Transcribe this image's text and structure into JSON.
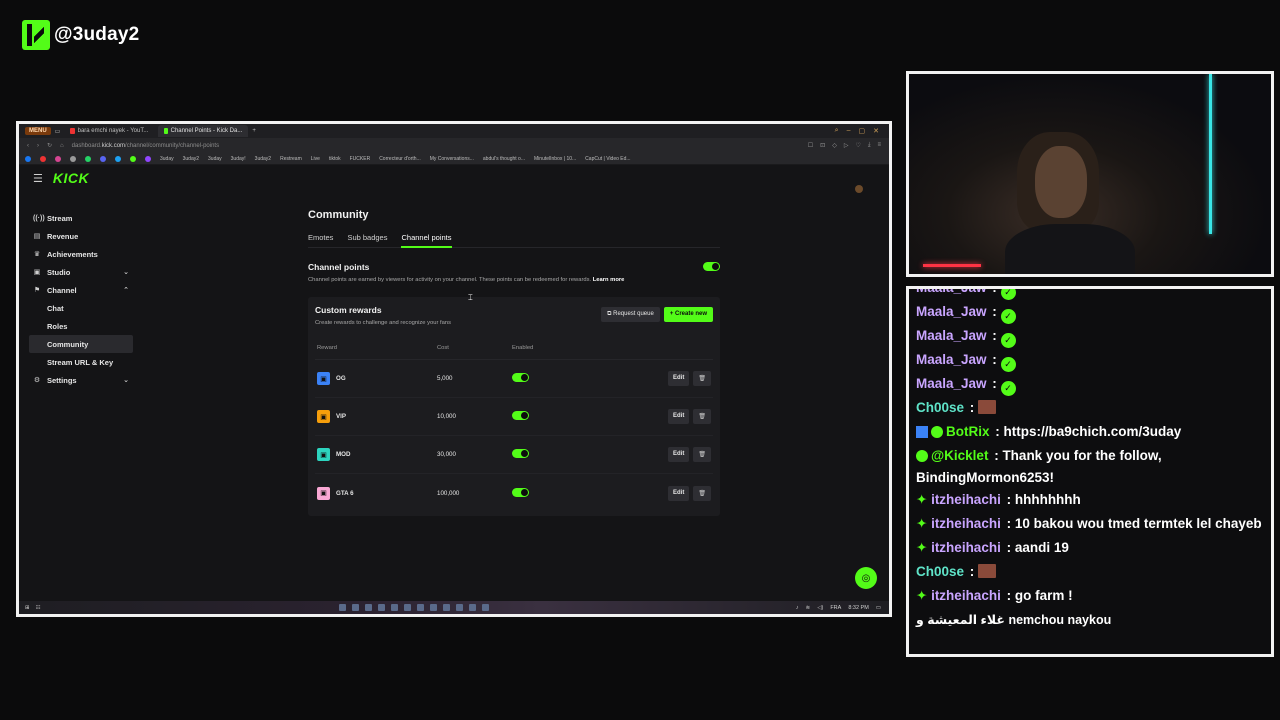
{
  "brand": {
    "handle": "@3uday2"
  },
  "browser": {
    "menu_label": "MENU",
    "tabs": [
      {
        "label": "bara emchi nayek - YouT..."
      },
      {
        "label": "Channel Points - Kick Da..."
      }
    ],
    "url_prefix": "dashboard.",
    "url_domain": "kick.com",
    "url_path": "/channel/community/channel-points",
    "bookmarks": [
      "3uday",
      "3uday2",
      "3uday",
      "3uday!",
      "3uday2",
      "Restream",
      "Live",
      "tiktok",
      "FUCKER",
      "Correcteur d'orth...",
      "My Conversations...",
      "abdul's thought o...",
      "MinutelInbox | 10...",
      "CapCut | Video Ed..."
    ]
  },
  "dashboard": {
    "logo": "KICK",
    "sidebar": {
      "items": [
        {
          "label": "Stream",
          "icon": "stream-icon"
        },
        {
          "label": "Revenue",
          "icon": "revenue-icon"
        },
        {
          "label": "Achievements",
          "icon": "trophy-icon"
        },
        {
          "label": "Studio",
          "icon": "studio-icon"
        },
        {
          "label": "Channel",
          "icon": "channel-icon"
        }
      ],
      "channel_sub": [
        "Chat",
        "Roles",
        "Community",
        "Stream URL & Key"
      ],
      "settings_label": "Settings"
    },
    "page_title": "Community",
    "tabs": [
      "Emotes",
      "Sub badges",
      "Channel points"
    ],
    "active_tab": "Channel points",
    "channel_points": {
      "title": "Channel points",
      "description": "Channel points are earned by viewers for activity on your channel. These points can be redeemed for rewards.",
      "learn_more": "Learn more",
      "enabled": true
    },
    "custom_rewards": {
      "title": "Custom rewards",
      "subtitle": "Create rewards to challenge and recognize your fans",
      "request_queue_label": "Request queue",
      "create_new_label": "Create new",
      "columns": [
        "Reward",
        "Cost",
        "Enabled"
      ],
      "rows": [
        {
          "name": "OG",
          "cost": "5,000",
          "enabled": true,
          "color": "#3b82f6"
        },
        {
          "name": "VIP",
          "cost": "10,000",
          "enabled": true,
          "color": "#f59e0b"
        },
        {
          "name": "MOD",
          "cost": "30,000",
          "enabled": true,
          "color": "#2dd4bf"
        },
        {
          "name": "GTA 6",
          "cost": "100,000",
          "enabled": true,
          "color": "#f9a8d4"
        }
      ],
      "edit_label": "Edit"
    }
  },
  "taskbar": {
    "lang": "FRA",
    "time": "8:32 PM"
  },
  "chat": {
    "messages": [
      {
        "user": "Maala_Jaw",
        "color": "#c9a5ff",
        "text": "",
        "verified": true
      },
      {
        "user": "Maala_Jaw",
        "color": "#c9a5ff",
        "text": "",
        "verified": true
      },
      {
        "user": "Maala_Jaw",
        "color": "#c9a5ff",
        "text": "",
        "verified": true
      },
      {
        "user": "Maala_Jaw",
        "color": "#c9a5ff",
        "text": "",
        "verified": true
      },
      {
        "user": "Maala_Jaw",
        "color": "#c9a5ff",
        "text": "",
        "verified": true
      },
      {
        "user": "Ch00se",
        "color": "#5fe3c8",
        "text": "",
        "emote": true
      },
      {
        "user": "BotRix",
        "color": "#53fc18",
        "text": "https://ba9chich.com/3uday",
        "bot": true
      },
      {
        "user": "@Kicklet",
        "color": "#53fc18",
        "text": "Thank you for the follow,",
        "cont": "BindingMormon6253!",
        "bot": true
      },
      {
        "user": "itzheihachi",
        "color": "#c9a5ff",
        "text": "hhhhhhhh",
        "sub": true
      },
      {
        "user": "itzheihachi",
        "color": "#c9a5ff",
        "text": "10 bakou wou tmed termtek lel chayeb",
        "sub": true
      },
      {
        "user": "itzheihachi",
        "color": "#c9a5ff",
        "text": "aandi 19",
        "sub": true
      },
      {
        "user": "Ch00se",
        "color": "#5fe3c8",
        "text": "",
        "emote": true
      },
      {
        "user": "itzheihachi",
        "color": "#c9a5ff",
        "text": "go farm !",
        "sub": true
      },
      {
        "user": "",
        "color": "#ffffff",
        "text": "nemchou naykou",
        "prefix": "غلاء المعيشة و"
      }
    ]
  }
}
